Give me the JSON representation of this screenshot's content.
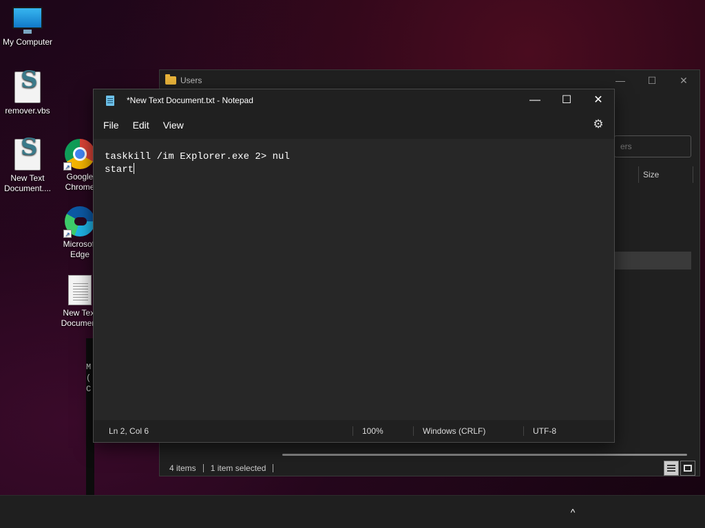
{
  "desktop": {
    "icons": [
      {
        "label": "My Computer",
        "icon": "monitor-icon"
      },
      {
        "label": "remover.vbs",
        "icon": "vbs-script-icon"
      },
      {
        "label": "New Text Document....",
        "icon": "vbs-script-icon"
      },
      {
        "label": "Google Chrome",
        "icon": "chrome-icon"
      },
      {
        "label": "Microsoft Edge",
        "icon": "edge-icon"
      },
      {
        "label": "New Text Document",
        "icon": "text-file-icon"
      }
    ]
  },
  "explorer": {
    "title": "Users",
    "search_placeholder": "ers",
    "column_size": "Size",
    "status_items": "4 items",
    "status_selected": "1 item selected"
  },
  "notepad": {
    "title": "*New Text Document.txt - Notepad",
    "menu": [
      "File",
      "Edit",
      "View"
    ],
    "content_line1": "taskkill /im Explorer.exe 2> nul",
    "content_line2": "start",
    "status": {
      "position": "Ln 2, Col 6",
      "zoom": "100%",
      "line_ending": "Windows (CRLF)",
      "encoding": "UTF-8"
    }
  },
  "window_controls": {
    "minimize": "—",
    "maximize": "☐",
    "close": "✕"
  },
  "console_fragment": "M\n(\nC",
  "taskbar": {
    "tray_chevron": "^"
  }
}
